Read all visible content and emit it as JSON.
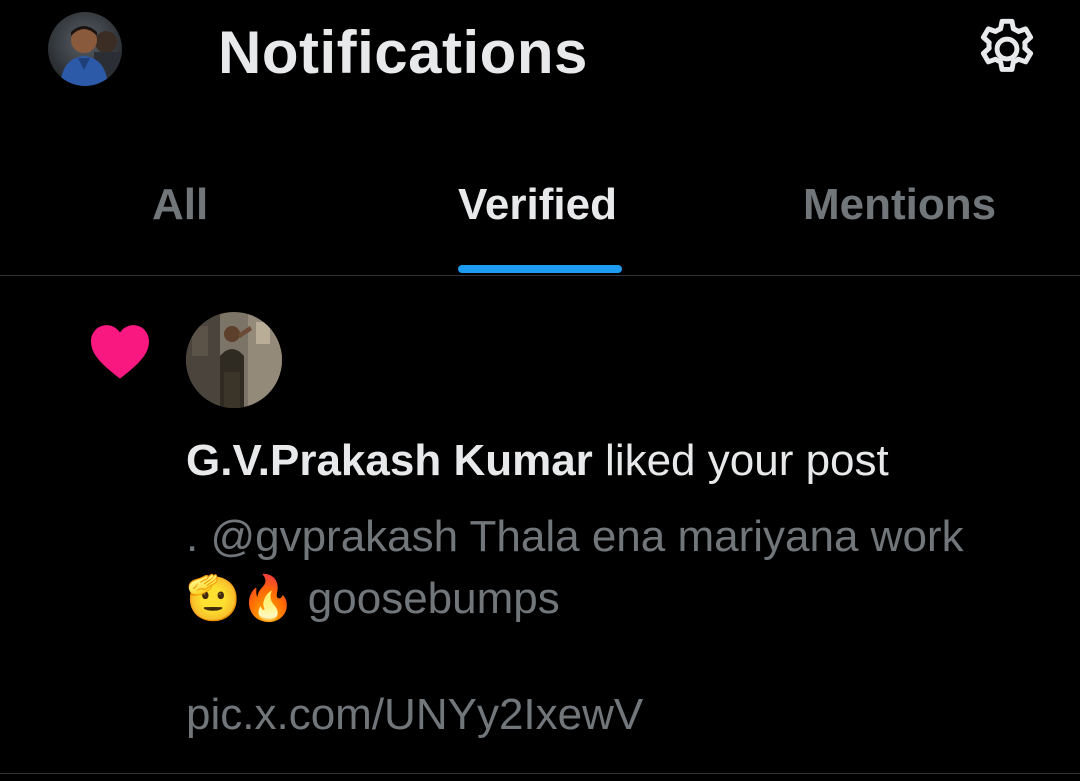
{
  "header": {
    "title": "Notifications",
    "avatar_icon": "profile-avatar",
    "settings_icon": "gear-icon"
  },
  "tabs": [
    {
      "label": "All",
      "active": false
    },
    {
      "label": "Verified",
      "active": true
    },
    {
      "label": "Mentions",
      "active": false
    }
  ],
  "notification": {
    "type_icon": "heart-icon",
    "actor_name": "G.V.Prakash Kumar",
    "action_text": " liked your post",
    "post_line1": ". @gvprakash Thala ena mariyana work",
    "post_line2": "🫡🔥 goosebumps",
    "post_link": "pic.x.com/UNYy2IxewV"
  },
  "colors": {
    "background": "#000000",
    "primary_text": "#e7e9ea",
    "secondary_text": "#71767b",
    "accent": "#1d9bf0",
    "like": "#f91880",
    "divider": "#2f3336"
  }
}
